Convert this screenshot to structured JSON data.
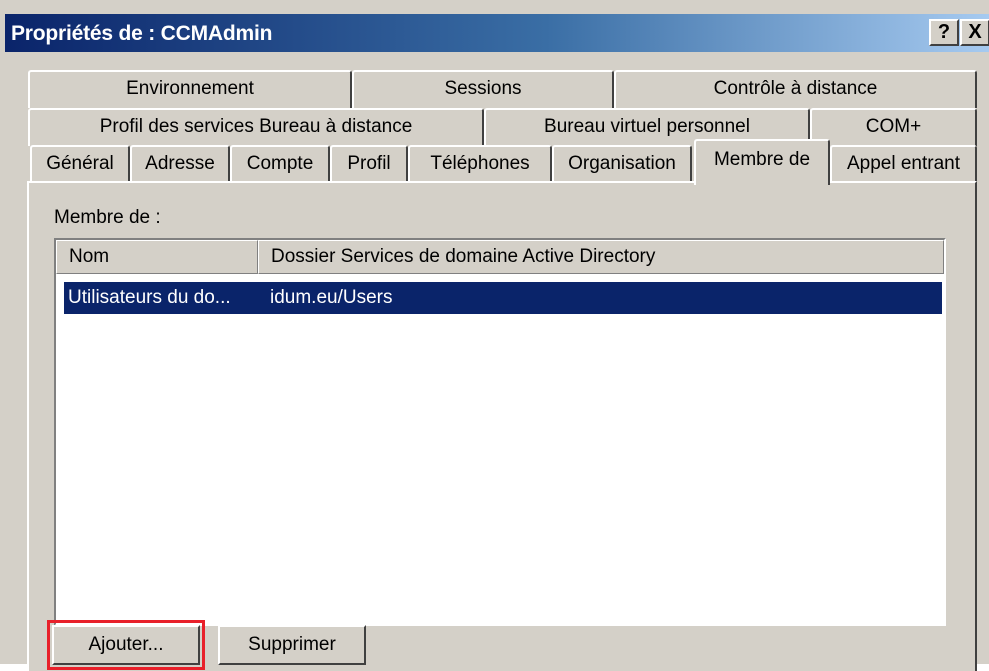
{
  "window": {
    "title": "Propriétés de : CCMAdmin",
    "help_label": "?",
    "close_label": "X"
  },
  "tabs": {
    "row1": [
      "Environnement",
      "Sessions",
      "Contrôle à distance"
    ],
    "row2": [
      "Profil des services Bureau à distance",
      "Bureau virtuel personnel",
      "COM+"
    ],
    "row3": [
      "Général",
      "Adresse",
      "Compte",
      "Profil",
      "Téléphones",
      "Organisation",
      "Membre de",
      "Appel entrant"
    ],
    "active": "Membre de"
  },
  "member_of": {
    "label": "Membre de :",
    "columns": [
      "Nom",
      "Dossier Services de domaine Active Directory"
    ],
    "rows": [
      {
        "name": "Utilisateurs du do...",
        "folder": "idum.eu/Users",
        "selected": true
      }
    ]
  },
  "buttons": {
    "add": "Ajouter...",
    "remove": "Supprimer"
  },
  "colors": {
    "selection": "#0a246a",
    "highlight": "#e8202a"
  }
}
